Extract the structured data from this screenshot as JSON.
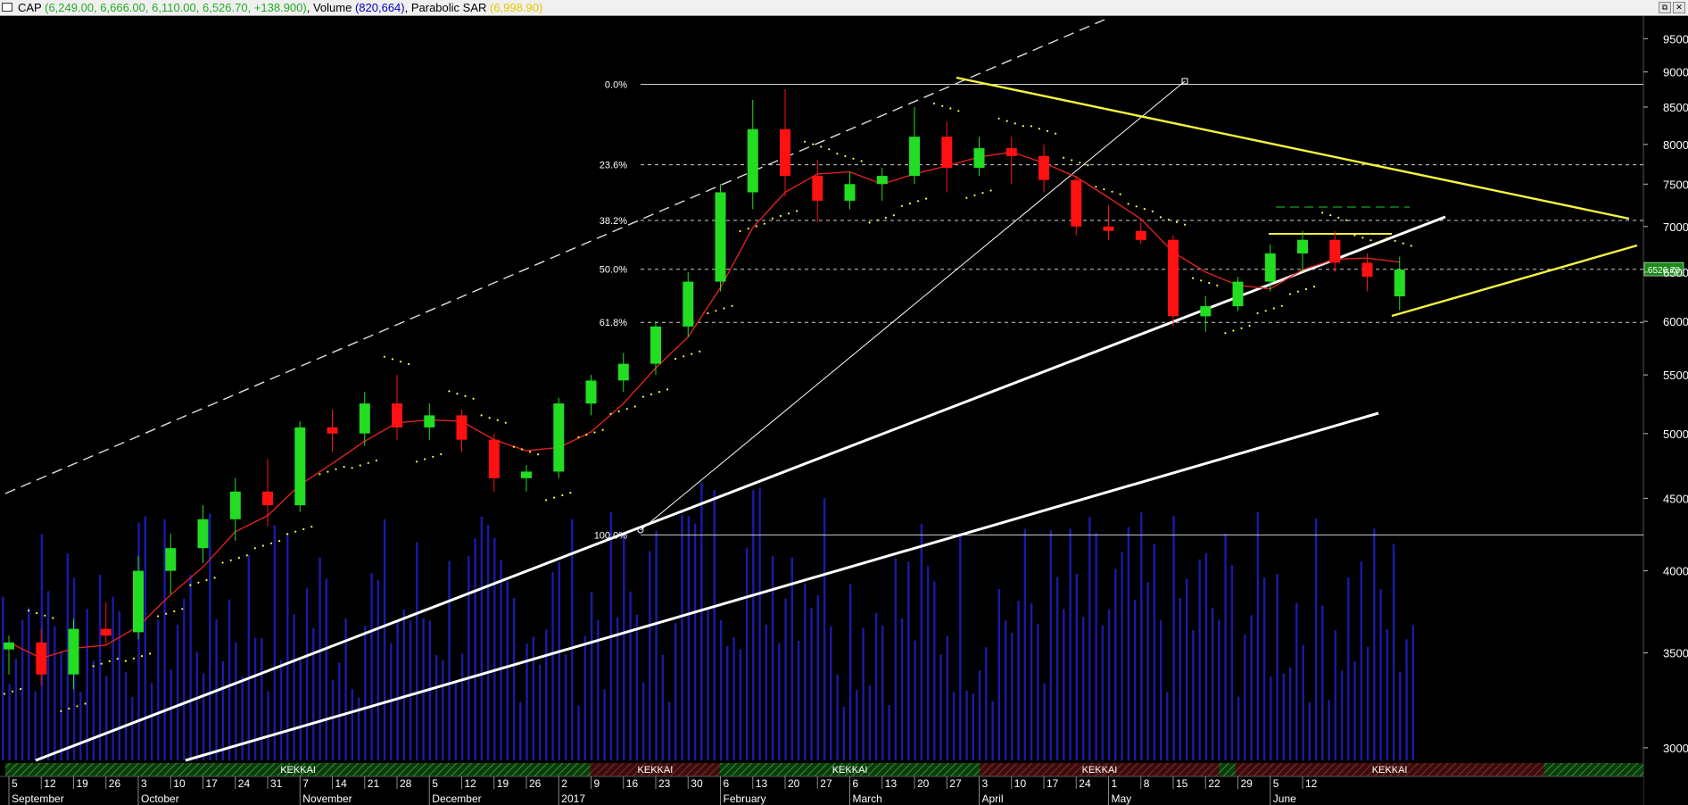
{
  "titlebar": {
    "symbol": "CAP",
    "ohlc": "(6,249.00, 6,666.00, 6,110.00, 6,526.70, +138.900)",
    "volume_label": "Volume",
    "volume_value": "(820,664)",
    "sar_label": "Parabolic SAR",
    "sar_value": "(6,998.90)",
    "restore_glyph": "⧉",
    "close_glyph": "✕"
  },
  "colors": {
    "background": "#000000",
    "up_candle": "#22dd22",
    "down_candle": "#ff1111",
    "neutral_candle": "#9090cc",
    "volume": "#1a1aaa",
    "moving_average": "#dd2222",
    "sar_dots": "#ffff44",
    "trend_white": "#ffffff",
    "trend_yellow": "#f5f542",
    "ohlc_text": "#22aa22",
    "volume_text": "#0000cc",
    "sar_text": "#e6c800",
    "last_price_box": "#1a8a1a",
    "band_green": "#0d3a0d",
    "band_red": "#3a0d0d"
  },
  "chart_data": {
    "type": "candlestick",
    "y_axis": {
      "scale": "log",
      "range": [
        2900,
        9700
      ],
      "ticks": [
        3000,
        3500,
        4000,
        4500,
        5000,
        5500,
        6000,
        6500,
        7000,
        7500,
        8000,
        8500,
        9000,
        9500
      ]
    },
    "last_price": "6526.70",
    "fib": {
      "high": 8820,
      "low": 4240,
      "levels": [
        {
          "label": "0.0%",
          "price": 8820
        },
        {
          "label": "23.6%",
          "price": 7739
        },
        {
          "label": "38.2%",
          "price": 7070
        },
        {
          "label": "50.0%",
          "price": 6530
        },
        {
          "label": "61.8%",
          "price": 5990
        },
        {
          "label": "100.0%",
          "price": 4240
        }
      ]
    },
    "x_days": [
      "5",
      "12",
      "19",
      "26",
      "3",
      "10",
      "17",
      "24",
      "31",
      "7",
      "14",
      "21",
      "28",
      "5",
      "12",
      "19",
      "26",
      "2",
      "9",
      "16",
      "23",
      "30",
      "6",
      "13",
      "20",
      "27",
      "6",
      "13",
      "20",
      "27",
      "3",
      "10",
      "17",
      "24",
      "1",
      "8",
      "15",
      "22",
      "29",
      "5",
      "12"
    ],
    "x_months": [
      {
        "label": "September",
        "index": 0
      },
      {
        "label": "October",
        "index": 4
      },
      {
        "label": "November",
        "index": 9
      },
      {
        "label": "December",
        "index": 13
      },
      {
        "label": "2017",
        "index": 17
      },
      {
        "label": "February",
        "index": 22
      },
      {
        "label": "March",
        "index": 26
      },
      {
        "label": "April",
        "index": 30
      },
      {
        "label": "May",
        "index": 34
      },
      {
        "label": "June",
        "index": 39
      }
    ],
    "band_label": "KEKKAI",
    "bands": [
      {
        "start": 0,
        "end": 21.8,
        "color": "green",
        "label": "KEKKAI"
      },
      {
        "start": 21.8,
        "end": 26.6,
        "color": "red",
        "label": "KEKKAI"
      },
      {
        "start": 26.6,
        "end": 36.3,
        "color": "green",
        "label": "KEKKAI"
      },
      {
        "start": 36.3,
        "end": 45.2,
        "color": "red",
        "label": "KEKKAI"
      },
      {
        "start": 45.2,
        "end": 45.8,
        "color": "green",
        "label": ""
      },
      {
        "start": 45.8,
        "end": 57.3,
        "color": "red",
        "label": "KEKKAI"
      },
      {
        "start": 57.3,
        "end": 61,
        "color": "green",
        "label": ""
      }
    ],
    "weekly": [
      {
        "o": 3520,
        "h": 3600,
        "l": 3380,
        "c": 3560
      },
      {
        "o": 3560,
        "h": 3640,
        "l": 3320,
        "c": 3380
      },
      {
        "o": 3380,
        "h": 3700,
        "l": 3300,
        "c": 3640
      },
      {
        "o": 3640,
        "h": 3800,
        "l": 3550,
        "c": 3600
      },
      {
        "o": 3620,
        "h": 4100,
        "l": 3580,
        "c": 4000
      },
      {
        "o": 4000,
        "h": 4250,
        "l": 3850,
        "c": 4150
      },
      {
        "o": 4150,
        "h": 4450,
        "l": 4050,
        "c": 4350
      },
      {
        "o": 4350,
        "h": 4650,
        "l": 4200,
        "c": 4550
      },
      {
        "o": 4550,
        "h": 4800,
        "l": 4300,
        "c": 4450
      },
      {
        "o": 4450,
        "h": 5100,
        "l": 4400,
        "c": 5050
      },
      {
        "o": 5050,
        "h": 5200,
        "l": 4850,
        "c": 5000
      },
      {
        "o": 5000,
        "h": 5350,
        "l": 4900,
        "c": 5250
      },
      {
        "o": 5250,
        "h": 5500,
        "l": 4950,
        "c": 5050
      },
      {
        "o": 5050,
        "h": 5250,
        "l": 4950,
        "c": 5150
      },
      {
        "o": 5150,
        "h": 5200,
        "l": 4850,
        "c": 4950
      },
      {
        "o": 4950,
        "h": 5000,
        "l": 4550,
        "c": 4650
      },
      {
        "o": 4650,
        "h": 4750,
        "l": 4550,
        "c": 4700
      },
      {
        "o": 4700,
        "h": 5300,
        "l": 4650,
        "c": 5250
      },
      {
        "o": 5250,
        "h": 5500,
        "l": 5150,
        "c": 5450
      },
      {
        "o": 5450,
        "h": 5700,
        "l": 5350,
        "c": 5600
      },
      {
        "o": 5600,
        "h": 6000,
        "l": 5500,
        "c": 5950
      },
      {
        "o": 5950,
        "h": 6500,
        "l": 5850,
        "c": 6400
      },
      {
        "o": 6400,
        "h": 7500,
        "l": 6300,
        "c": 7400
      },
      {
        "o": 7400,
        "h": 8600,
        "l": 7200,
        "c": 8200
      },
      {
        "o": 8200,
        "h": 8750,
        "l": 7350,
        "c": 7600
      },
      {
        "o": 7600,
        "h": 7800,
        "l": 7050,
        "c": 7300
      },
      {
        "o": 7300,
        "h": 7650,
        "l": 7200,
        "c": 7500
      },
      {
        "o": 7500,
        "h": 7700,
        "l": 7300,
        "c": 7600
      },
      {
        "o": 7600,
        "h": 8500,
        "l": 7500,
        "c": 8100
      },
      {
        "o": 8100,
        "h": 8300,
        "l": 7400,
        "c": 7700
      },
      {
        "o": 7700,
        "h": 8100,
        "l": 7600,
        "c": 7950
      },
      {
        "o": 7950,
        "h": 8100,
        "l": 7500,
        "c": 7850
      },
      {
        "o": 7850,
        "h": 8000,
        "l": 7400,
        "c": 7550
      },
      {
        "o": 7550,
        "h": 7600,
        "l": 6900,
        "c": 7000
      },
      {
        "o": 7000,
        "h": 7250,
        "l": 6850,
        "c": 6950
      },
      {
        "o": 6950,
        "h": 7050,
        "l": 6800,
        "c": 6850
      },
      {
        "o": 6850,
        "h": 6900,
        "l": 5950,
        "c": 6050
      },
      {
        "o": 6050,
        "h": 6250,
        "l": 5900,
        "c": 6150
      },
      {
        "o": 6150,
        "h": 6450,
        "l": 6100,
        "c": 6400
      },
      {
        "o": 6400,
        "h": 6800,
        "l": 6300,
        "c": 6700
      },
      {
        "o": 6700,
        "h": 6950,
        "l": 6500,
        "c": 6850
      },
      {
        "o": 6850,
        "h": 6950,
        "l": 6500,
        "c": 6600
      },
      {
        "o": 6600,
        "h": 6700,
        "l": 6300,
        "c": 6450
      },
      {
        "o": 6249,
        "h": 6666,
        "l": 6110,
        "c": 6526.7
      }
    ]
  }
}
